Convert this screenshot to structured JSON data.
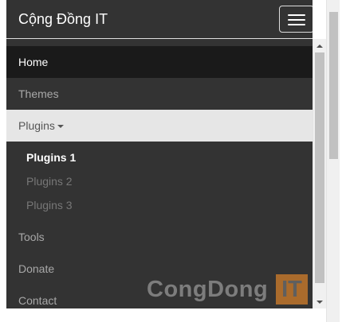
{
  "navbar": {
    "brand": "Cộng Đồng IT"
  },
  "nav": {
    "items": [
      {
        "label": "Home",
        "state": "active"
      },
      {
        "label": "Themes",
        "state": "normal"
      },
      {
        "label": "Plugins",
        "state": "open",
        "dropdown": [
          {
            "label": "Plugins 1",
            "state": "active"
          },
          {
            "label": "Plugins 2",
            "state": "normal"
          },
          {
            "label": "Plugins 3",
            "state": "normal"
          }
        ]
      },
      {
        "label": "Tools",
        "state": "normal"
      },
      {
        "label": "Donate",
        "state": "normal"
      },
      {
        "label": "Contact",
        "state": "normal"
      }
    ]
  },
  "watermark": {
    "text": "CongDong",
    "box_text": "IT"
  },
  "colors": {
    "navbar_bg": "#333333",
    "active_bg": "#1a1a1a",
    "open_bg": "#e6e6e6",
    "watermark_accent": "#c8792b"
  }
}
